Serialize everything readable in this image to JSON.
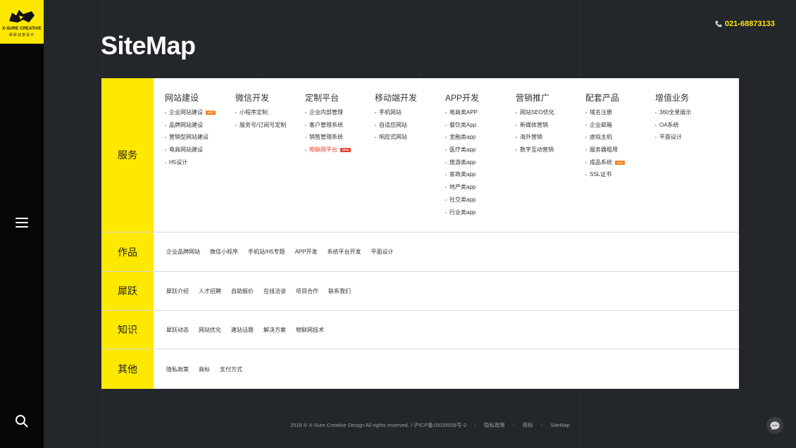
{
  "brand": {
    "name": "X-SURE CREATIVE",
    "tagline": "犀跃创意设计"
  },
  "header": {
    "title": "SiteMap",
    "phone": "021-68873133"
  },
  "colors": {
    "accent": "#ffe800",
    "background": "#23262b",
    "sidebar": "#060606",
    "hot": "#f47f1e",
    "highlight": "#e8412b"
  },
  "sitemap": {
    "services": {
      "label": "服务",
      "columns": [
        {
          "title": "网站建设",
          "items": [
            {
              "text": "企业网站建设",
              "badge": "HOT"
            },
            {
              "text": "品牌网站建设"
            },
            {
              "text": "营销型网站建设"
            },
            {
              "text": "电商网站建设"
            },
            {
              "text": "H5设计"
            }
          ]
        },
        {
          "title": "微信开发",
          "items": [
            {
              "text": "小程序定制"
            },
            {
              "text": "服务号/订阅号定制"
            }
          ]
        },
        {
          "title": "定制平台",
          "items": [
            {
              "text": "企业内部管理"
            },
            {
              "text": "客户管理系统"
            },
            {
              "text": "销售管理系统"
            },
            {
              "text": "物联网平台",
              "badge": "NEW",
              "highlight": true
            }
          ]
        },
        {
          "title": "移动端开发",
          "items": [
            {
              "text": "手机网站"
            },
            {
              "text": "自适应网站"
            },
            {
              "text": "响应式网站"
            }
          ]
        },
        {
          "title": "APP开发",
          "items": [
            {
              "text": "电商类APP"
            },
            {
              "text": "餐饮类App"
            },
            {
              "text": "金融类app"
            },
            {
              "text": "医疗类app"
            },
            {
              "text": "旅游类app"
            },
            {
              "text": "家政类app"
            },
            {
              "text": "地产类app"
            },
            {
              "text": "社交类app"
            },
            {
              "text": "行业类app"
            }
          ]
        },
        {
          "title": "营销推广",
          "items": [
            {
              "text": "网站SEO优化"
            },
            {
              "text": "新媒体营销"
            },
            {
              "text": "海外营销"
            },
            {
              "text": "数字互动营销"
            }
          ]
        },
        {
          "title": "配套产品",
          "items": [
            {
              "text": "域名注册"
            },
            {
              "text": "企业邮箱"
            },
            {
              "text": "虚拟主机"
            },
            {
              "text": "服务器租用"
            },
            {
              "text": "成品系统",
              "badge": "new"
            },
            {
              "text": "SSL证书"
            }
          ]
        },
        {
          "title": "增值业务",
          "items": [
            {
              "text": "360全景展示"
            },
            {
              "text": "OA系统"
            },
            {
              "text": "平面设计"
            }
          ]
        }
      ]
    },
    "works": {
      "label": "作品",
      "links": [
        "企业品牌网站",
        "微信小程序",
        "手机站/H5专题",
        "APP开发",
        "系统平台开发",
        "平面设计"
      ]
    },
    "about": {
      "label": "犀跃",
      "links": [
        "犀跃介绍",
        "人才招聘",
        "自助报价",
        "在线洽谈",
        "项目合作",
        "联系我们"
      ]
    },
    "knowledge": {
      "label": "知识",
      "links": [
        "犀跃动态",
        "网站优化",
        "建站话题",
        "解决方案",
        "物联网技术"
      ]
    },
    "other": {
      "label": "其他",
      "links": [
        "隐私政策",
        "商标",
        "支付方式"
      ]
    }
  },
  "footer": {
    "copyright": "2018 © X-Sure Creative Design All rights reserved. / 沪ICP备15039008号-2",
    "links": [
      "隐私政策",
      "商标",
      "SiteMap"
    ],
    "separator": "-"
  },
  "icons": {
    "menu": "hamburger-icon",
    "search": "search-icon",
    "phone": "phone-icon",
    "chat": "chat-icon",
    "logo": "rhino-logo-icon"
  }
}
